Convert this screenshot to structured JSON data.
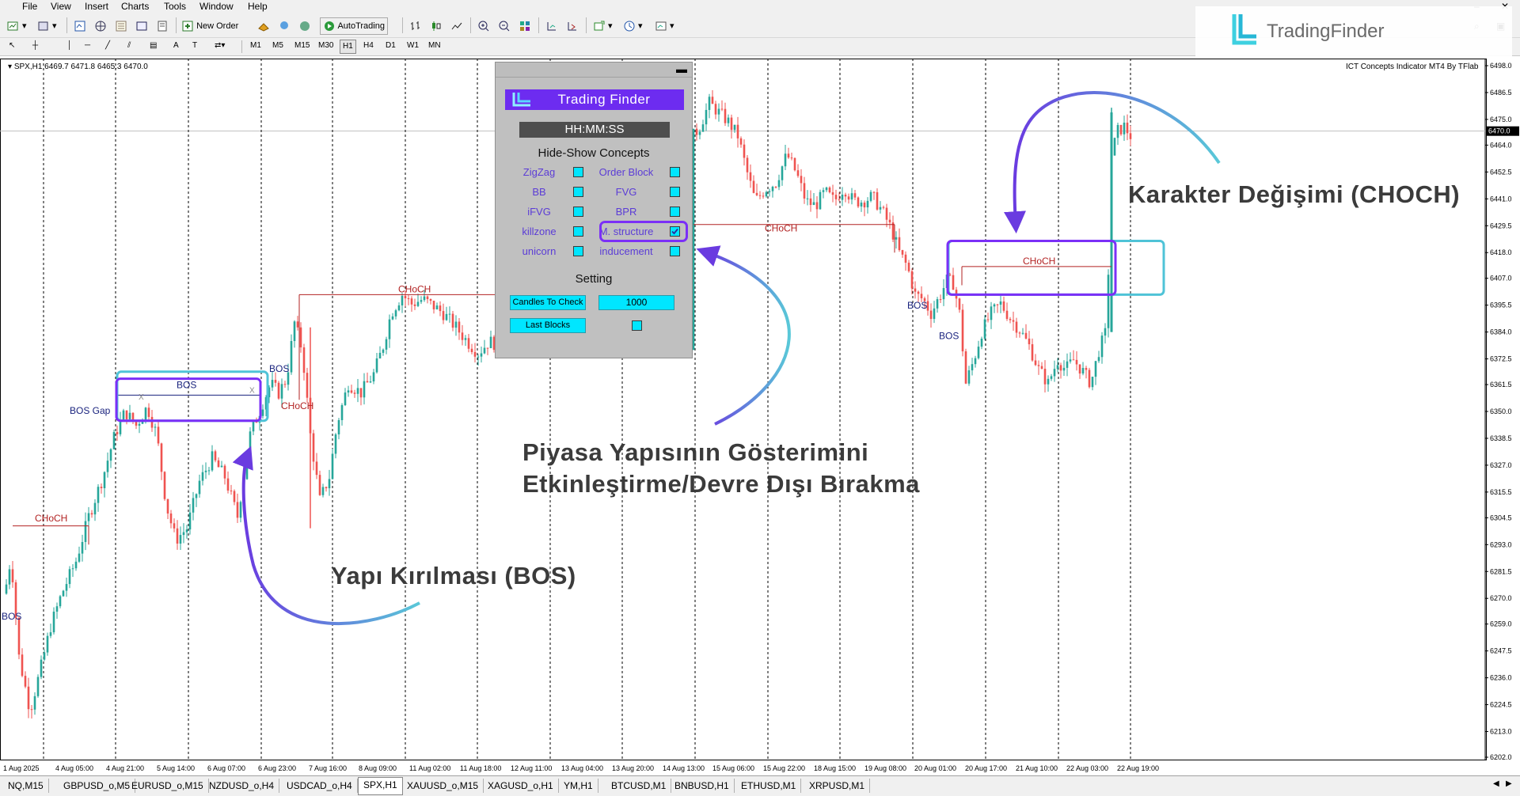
{
  "menu": [
    "File",
    "View",
    "Insert",
    "Charts",
    "Tools",
    "Window",
    "Help"
  ],
  "toolbar": {
    "new_order": "New Order",
    "auto_trading": "AutoTrading"
  },
  "timeframes": [
    "M1",
    "M5",
    "M15",
    "M30",
    "H1",
    "H4",
    "D1",
    "W1",
    "MN"
  ],
  "brand": {
    "name": "TradingFinder"
  },
  "chart": {
    "symbol_info": "SPX,H1  6469.7 6471.8 6465.3 6470.0",
    "indicator_title": "ICT Concepts Indicator MT4 By TFlab",
    "current_price": "6470.0",
    "price_labels": [
      "6498.0",
      "6486.5",
      "6475.0",
      "6464.0",
      "6452.5",
      "6441.0",
      "6429.5",
      "6418.0",
      "6407.0",
      "6395.5",
      "6384.0",
      "6372.5",
      "6361.5",
      "6350.0",
      "6338.5",
      "6327.0",
      "6315.5",
      "6304.5",
      "6293.0",
      "6281.5",
      "6270.0",
      "6259.0",
      "6247.5",
      "6236.0",
      "6224.5",
      "6213.0",
      "6202.0"
    ],
    "time_labels": [
      "1 Aug 2025",
      "4 Aug 05:00",
      "4 Aug 21:00",
      "5 Aug 14:00",
      "6 Aug 07:00",
      "6 Aug 23:00",
      "7 Aug 16:00",
      "8 Aug 09:00",
      "11 Aug 02:00",
      "11 Aug 18:00",
      "12 Aug 11:00",
      "13 Aug 04:00",
      "13 Aug 20:00",
      "14 Aug 13:00",
      "15 Aug 06:00",
      "15 Aug 22:00",
      "18 Aug 15:00",
      "19 Aug 08:00",
      "20 Aug 01:00",
      "20 Aug 17:00",
      "21 Aug 10:00",
      "22 Aug 03:00",
      "22 Aug 19:00"
    ],
    "structure_labels": {
      "bos": "BOS",
      "bos_gap": "BOS Gap",
      "choch": "CHoCH",
      "x": "X"
    }
  },
  "panel": {
    "logo": "Trading Finder",
    "clock": "HH:MM:SS",
    "hide_show_title": "Hide-Show Concepts",
    "items": [
      {
        "label": "ZigZag",
        "checked": false
      },
      {
        "label": "Order Block",
        "checked": false
      },
      {
        "label": "BB",
        "checked": false
      },
      {
        "label": "FVG",
        "checked": false
      },
      {
        "label": "iFVG",
        "checked": false
      },
      {
        "label": "BPR",
        "checked": false
      },
      {
        "label": "killzone",
        "checked": false
      },
      {
        "label": "M. structure",
        "checked": true
      },
      {
        "label": "unicorn",
        "checked": false
      },
      {
        "label": "inducement",
        "checked": false
      }
    ],
    "setting_title": "Setting",
    "candles_btn": "Candles To Check",
    "candles_value": "1000",
    "last_blocks_btn": "Last Blocks"
  },
  "annotations": {
    "choch": "Karakter Değişimi (CHOCH)",
    "structure_line1": "Piyasa Yapısının Gösterimini",
    "structure_line2": "Etkinleştirme/Devre Dışı Bırakma",
    "bos": "Yapı Kırılması (BOS)"
  },
  "tabs": [
    "NQ,M15",
    "GBPUSD_o,M5",
    "EURUSD_o,M15",
    "NZDUSD_o,H4",
    "USDCAD_o,H4",
    "SPX,H1",
    "XAUUSD_o,M15",
    "XAGUSD_o,H1",
    "YM,H1",
    "BTCUSD,M1",
    "BNBUSD,H1",
    "ETHUSD,M1",
    "XRPUSD,M1"
  ],
  "active_tab": "SPX,H1",
  "colors": {
    "bull": "#26a69a",
    "bear": "#ef5350",
    "structure": "#b22222",
    "bos_text": "#1a237e",
    "highlight_box": "#7b2ff7",
    "teal_box": "#4fc3d7",
    "arrow_start": "#6a3be0",
    "arrow_end": "#59c8d8"
  }
}
